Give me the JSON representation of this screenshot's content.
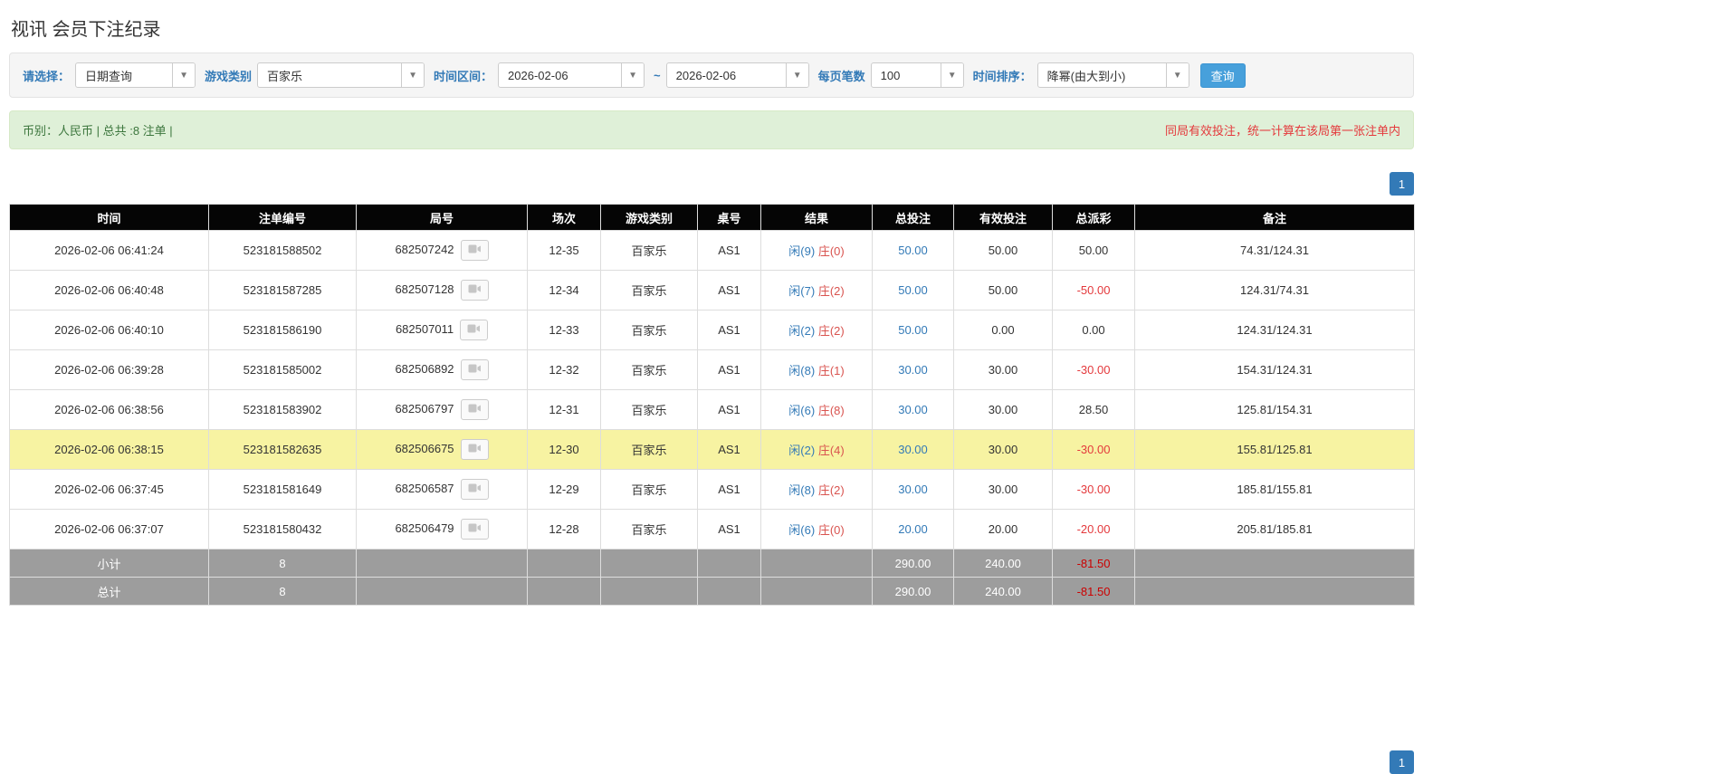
{
  "page": {
    "title": "视讯 会员下注纪录"
  },
  "filters": {
    "select_label": "请选择：",
    "select_value": "日期查询",
    "game_type_label": "游戏类别",
    "game_type_value": "百家乐",
    "date_range_label": "时间区间：",
    "date_from": "2026-02-06",
    "date_separator": "~",
    "date_to": "2026-02-06",
    "page_size_label": "每页笔数",
    "page_size_value": "100",
    "sort_label": "时间排序：",
    "sort_value": "降幂(由大到小)",
    "search_button": "查询"
  },
  "summary": {
    "left": "币别：人民币 | 总共 :8 注单 |",
    "right": "同局有效投注，统一计算在该局第一张注单内"
  },
  "pagination": {
    "page": "1"
  },
  "table": {
    "headers": [
      "时间",
      "注单编号",
      "局号",
      "场次",
      "游戏类别",
      "桌号",
      "结果",
      "总投注",
      "有效投注",
      "总派彩",
      "备注"
    ],
    "rows": [
      {
        "time": "2026-02-06 06:41:24",
        "bet_id": "523181588502",
        "round_id": "682507242",
        "session": "12-35",
        "game": "百家乐",
        "table": "AS1",
        "result_player": "闲(9)",
        "result_banker": "庄(0)",
        "total_bet": "50.00",
        "valid_bet": "50.00",
        "payout": "50.00",
        "remark": "74.31/124.31",
        "highlighted": false
      },
      {
        "time": "2026-02-06 06:40:48",
        "bet_id": "523181587285",
        "round_id": "682507128",
        "session": "12-34",
        "game": "百家乐",
        "table": "AS1",
        "result_player": "闲(7)",
        "result_banker": "庄(2)",
        "total_bet": "50.00",
        "valid_bet": "50.00",
        "payout": "-50.00",
        "remark": "124.31/74.31",
        "highlighted": false
      },
      {
        "time": "2026-02-06 06:40:10",
        "bet_id": "523181586190",
        "round_id": "682507011",
        "session": "12-33",
        "game": "百家乐",
        "table": "AS1",
        "result_player": "闲(2)",
        "result_banker": "庄(2)",
        "total_bet": "50.00",
        "valid_bet": "0.00",
        "payout": "0.00",
        "remark": "124.31/124.31",
        "highlighted": false
      },
      {
        "time": "2026-02-06 06:39:28",
        "bet_id": "523181585002",
        "round_id": "682506892",
        "session": "12-32",
        "game": "百家乐",
        "table": "AS1",
        "result_player": "闲(8)",
        "result_banker": "庄(1)",
        "total_bet": "30.00",
        "valid_bet": "30.00",
        "payout": "-30.00",
        "remark": "154.31/124.31",
        "highlighted": false
      },
      {
        "time": "2026-02-06 06:38:56",
        "bet_id": "523181583902",
        "round_id": "682506797",
        "session": "12-31",
        "game": "百家乐",
        "table": "AS1",
        "result_player": "闲(6)",
        "result_banker": "庄(8)",
        "total_bet": "30.00",
        "valid_bet": "30.00",
        "payout": "28.50",
        "remark": "125.81/154.31",
        "highlighted": false
      },
      {
        "time": "2026-02-06 06:38:15",
        "bet_id": "523181582635",
        "round_id": "682506675",
        "session": "12-30",
        "game": "百家乐",
        "table": "AS1",
        "result_player": "闲(2)",
        "result_banker": "庄(4)",
        "total_bet": "30.00",
        "valid_bet": "30.00",
        "payout": "-30.00",
        "remark": "155.81/125.81",
        "highlighted": true
      },
      {
        "time": "2026-02-06 06:37:45",
        "bet_id": "523181581649",
        "round_id": "682506587",
        "session": "12-29",
        "game": "百家乐",
        "table": "AS1",
        "result_player": "闲(8)",
        "result_banker": "庄(2)",
        "total_bet": "30.00",
        "valid_bet": "30.00",
        "payout": "-30.00",
        "remark": "185.81/155.81",
        "highlighted": false
      },
      {
        "time": "2026-02-06 06:37:07",
        "bet_id": "523181580432",
        "round_id": "682506479",
        "session": "12-28",
        "game": "百家乐",
        "table": "AS1",
        "result_player": "闲(6)",
        "result_banker": "庄(0)",
        "total_bet": "20.00",
        "valid_bet": "20.00",
        "payout": "-20.00",
        "remark": "205.81/185.81",
        "highlighted": false
      }
    ],
    "subtotal": {
      "label": "小计",
      "count": "8",
      "total_bet": "290.00",
      "valid_bet": "240.00",
      "payout": "-81.50"
    },
    "total": {
      "label": "总计",
      "count": "8",
      "total_bet": "290.00",
      "valid_bet": "240.00",
      "payout": "-81.50"
    }
  }
}
